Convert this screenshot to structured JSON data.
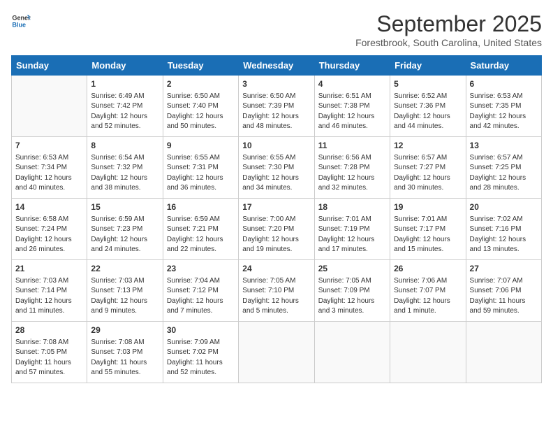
{
  "header": {
    "logo_line1": "General",
    "logo_line2": "Blue",
    "month": "September 2025",
    "location": "Forestbrook, South Carolina, United States"
  },
  "days_of_week": [
    "Sunday",
    "Monday",
    "Tuesday",
    "Wednesday",
    "Thursday",
    "Friday",
    "Saturday"
  ],
  "weeks": [
    [
      {
        "num": "",
        "data": ""
      },
      {
        "num": "1",
        "data": "Sunrise: 6:49 AM\nSunset: 7:42 PM\nDaylight: 12 hours\nand 52 minutes."
      },
      {
        "num": "2",
        "data": "Sunrise: 6:50 AM\nSunset: 7:40 PM\nDaylight: 12 hours\nand 50 minutes."
      },
      {
        "num": "3",
        "data": "Sunrise: 6:50 AM\nSunset: 7:39 PM\nDaylight: 12 hours\nand 48 minutes."
      },
      {
        "num": "4",
        "data": "Sunrise: 6:51 AM\nSunset: 7:38 PM\nDaylight: 12 hours\nand 46 minutes."
      },
      {
        "num": "5",
        "data": "Sunrise: 6:52 AM\nSunset: 7:36 PM\nDaylight: 12 hours\nand 44 minutes."
      },
      {
        "num": "6",
        "data": "Sunrise: 6:53 AM\nSunset: 7:35 PM\nDaylight: 12 hours\nand 42 minutes."
      }
    ],
    [
      {
        "num": "7",
        "data": "Sunrise: 6:53 AM\nSunset: 7:34 PM\nDaylight: 12 hours\nand 40 minutes."
      },
      {
        "num": "8",
        "data": "Sunrise: 6:54 AM\nSunset: 7:32 PM\nDaylight: 12 hours\nand 38 minutes."
      },
      {
        "num": "9",
        "data": "Sunrise: 6:55 AM\nSunset: 7:31 PM\nDaylight: 12 hours\nand 36 minutes."
      },
      {
        "num": "10",
        "data": "Sunrise: 6:55 AM\nSunset: 7:30 PM\nDaylight: 12 hours\nand 34 minutes."
      },
      {
        "num": "11",
        "data": "Sunrise: 6:56 AM\nSunset: 7:28 PM\nDaylight: 12 hours\nand 32 minutes."
      },
      {
        "num": "12",
        "data": "Sunrise: 6:57 AM\nSunset: 7:27 PM\nDaylight: 12 hours\nand 30 minutes."
      },
      {
        "num": "13",
        "data": "Sunrise: 6:57 AM\nSunset: 7:25 PM\nDaylight: 12 hours\nand 28 minutes."
      }
    ],
    [
      {
        "num": "14",
        "data": "Sunrise: 6:58 AM\nSunset: 7:24 PM\nDaylight: 12 hours\nand 26 minutes."
      },
      {
        "num": "15",
        "data": "Sunrise: 6:59 AM\nSunset: 7:23 PM\nDaylight: 12 hours\nand 24 minutes."
      },
      {
        "num": "16",
        "data": "Sunrise: 6:59 AM\nSunset: 7:21 PM\nDaylight: 12 hours\nand 22 minutes."
      },
      {
        "num": "17",
        "data": "Sunrise: 7:00 AM\nSunset: 7:20 PM\nDaylight: 12 hours\nand 19 minutes."
      },
      {
        "num": "18",
        "data": "Sunrise: 7:01 AM\nSunset: 7:19 PM\nDaylight: 12 hours\nand 17 minutes."
      },
      {
        "num": "19",
        "data": "Sunrise: 7:01 AM\nSunset: 7:17 PM\nDaylight: 12 hours\nand 15 minutes."
      },
      {
        "num": "20",
        "data": "Sunrise: 7:02 AM\nSunset: 7:16 PM\nDaylight: 12 hours\nand 13 minutes."
      }
    ],
    [
      {
        "num": "21",
        "data": "Sunrise: 7:03 AM\nSunset: 7:14 PM\nDaylight: 12 hours\nand 11 minutes."
      },
      {
        "num": "22",
        "data": "Sunrise: 7:03 AM\nSunset: 7:13 PM\nDaylight: 12 hours\nand 9 minutes."
      },
      {
        "num": "23",
        "data": "Sunrise: 7:04 AM\nSunset: 7:12 PM\nDaylight: 12 hours\nand 7 minutes."
      },
      {
        "num": "24",
        "data": "Sunrise: 7:05 AM\nSunset: 7:10 PM\nDaylight: 12 hours\nand 5 minutes."
      },
      {
        "num": "25",
        "data": "Sunrise: 7:05 AM\nSunset: 7:09 PM\nDaylight: 12 hours\nand 3 minutes."
      },
      {
        "num": "26",
        "data": "Sunrise: 7:06 AM\nSunset: 7:07 PM\nDaylight: 12 hours\nand 1 minute."
      },
      {
        "num": "27",
        "data": "Sunrise: 7:07 AM\nSunset: 7:06 PM\nDaylight: 11 hours\nand 59 minutes."
      }
    ],
    [
      {
        "num": "28",
        "data": "Sunrise: 7:08 AM\nSunset: 7:05 PM\nDaylight: 11 hours\nand 57 minutes."
      },
      {
        "num": "29",
        "data": "Sunrise: 7:08 AM\nSunset: 7:03 PM\nDaylight: 11 hours\nand 55 minutes."
      },
      {
        "num": "30",
        "data": "Sunrise: 7:09 AM\nSunset: 7:02 PM\nDaylight: 11 hours\nand 52 minutes."
      },
      {
        "num": "",
        "data": ""
      },
      {
        "num": "",
        "data": ""
      },
      {
        "num": "",
        "data": ""
      },
      {
        "num": "",
        "data": ""
      }
    ]
  ]
}
